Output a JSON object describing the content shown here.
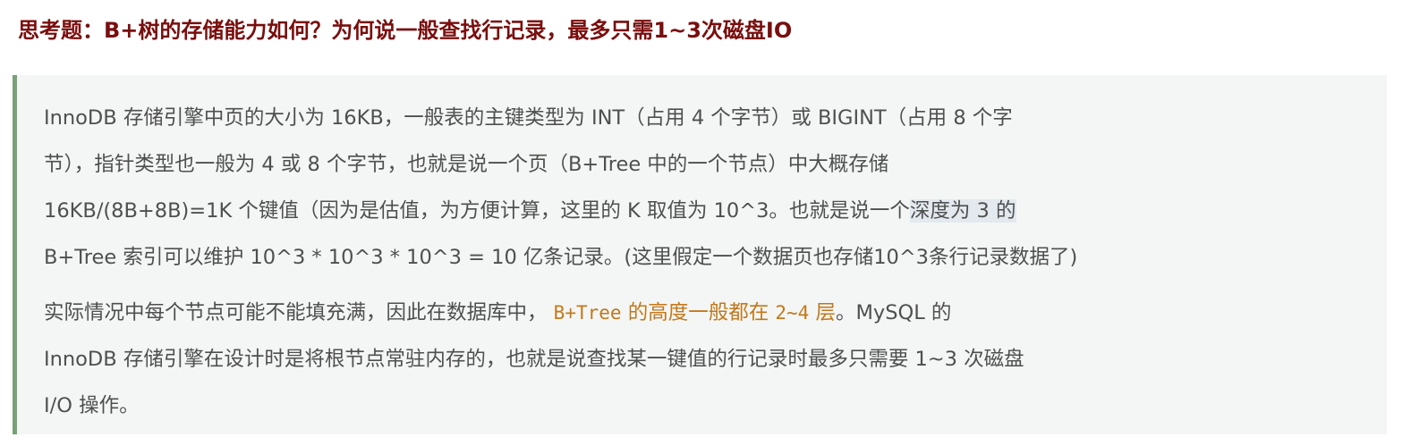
{
  "question": "思考题：B+树的存储能力如何？为何说一般查找行记录，最多只需1~3次磁盘IO",
  "paragraph1": {
    "line1": "InnoDB 存储引擎中页的大小为 16KB，一般表的主键类型为 INT（占用 4 个字节）或 BIGINT（占用 8 个字",
    "line2": "节），指针类型也一般为 4 或 8 个字节，也就是说一个页（B+Tree 中的一个节点）中大概存储",
    "line3_pre": "16KB/(8B+8B)=1K 个键值（因为是估值，为方便计算，这里的 K 取值为 10^3。也就是说一个",
    "line3_highlight": "深度为 3 的",
    "line4": "B+Tree 索引可以维护 10^3 * 10^3 * 10^3 = 10 亿条记录。(这里假定一个数据页也存储10^3条行记录数据了)"
  },
  "paragraph2": {
    "line1_pre": "实际情况中每个节点可能不能填充满，因此在数据库中，",
    "code1": "B+Tree",
    "code_mid": "的高度一般都在",
    "code2": "2~4",
    "code_end": "层",
    "line1_post": "。MySQL 的",
    "line2": "InnoDB 存储引擎在设计时是将根节点常驻内存的，也就是说查找某一键值的行记录时最多只需要 1~3 次磁盘",
    "line3": "I/O 操作。"
  }
}
